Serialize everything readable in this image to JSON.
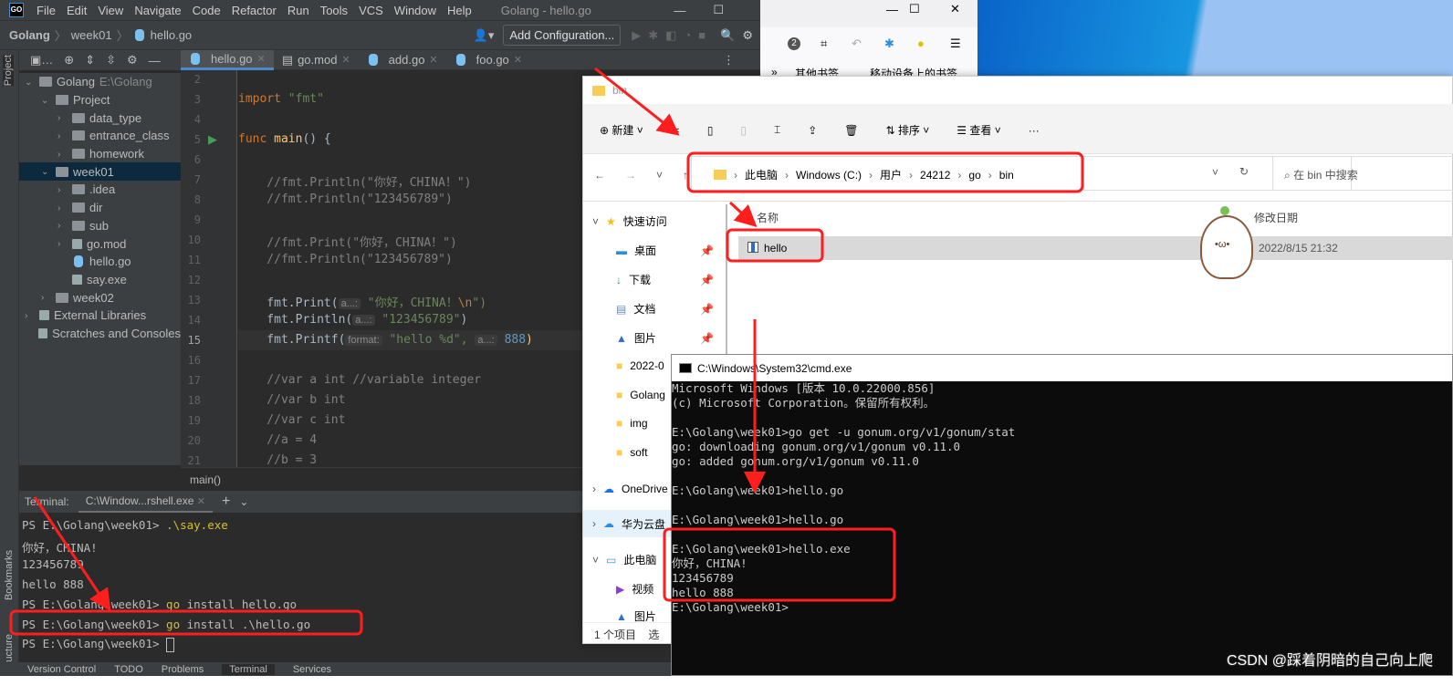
{
  "ide": {
    "title": "Golang - hello.go",
    "menu": [
      "File",
      "Edit",
      "View",
      "Navigate",
      "Code",
      "Refactor",
      "Run",
      "Tools",
      "VCS",
      "Window",
      "Help"
    ],
    "breadcrumb": [
      "Golang",
      "week01",
      "hello.go"
    ],
    "add_config": "Add Configuration...",
    "stripe_labels": {
      "project": "Project",
      "bookmarks": "Bookmarks",
      "structure": "Structure"
    },
    "tree": [
      {
        "label": "Golang",
        "hint": "E:\\Golang",
        "depth": 0,
        "open": true,
        "type": "folder"
      },
      {
        "label": "Project",
        "depth": 1,
        "open": true,
        "type": "folder"
      },
      {
        "label": "data_type",
        "depth": 2,
        "type": "folder"
      },
      {
        "label": "entrance_class",
        "depth": 2,
        "type": "folder"
      },
      {
        "label": "homework",
        "depth": 2,
        "type": "folder"
      },
      {
        "label": "week01",
        "depth": 1,
        "open": true,
        "type": "folder",
        "selected": true
      },
      {
        "label": ".idea",
        "depth": 2,
        "type": "folder"
      },
      {
        "label": "dir",
        "depth": 2,
        "type": "folder"
      },
      {
        "label": "sub",
        "depth": 2,
        "type": "folder"
      },
      {
        "label": "go.mod",
        "depth": 2,
        "type": "file"
      },
      {
        "label": "hello.go",
        "depth": 2,
        "type": "go"
      },
      {
        "label": "say.exe",
        "depth": 2,
        "type": "file"
      },
      {
        "label": "week02",
        "depth": 1,
        "type": "folder"
      },
      {
        "label": "External Libraries",
        "depth": 0,
        "type": "lib"
      },
      {
        "label": "Scratches and Consoles",
        "depth": 0,
        "type": "scratch"
      }
    ],
    "tabs": [
      "hello.go",
      "go.mod",
      "add.go",
      "foo.go"
    ],
    "line_numbers": [
      "2",
      "3",
      "4",
      "5",
      "6",
      "7",
      "8",
      "9",
      "10",
      "11",
      "12",
      "13",
      "14",
      "15",
      "16",
      "17",
      "18",
      "19",
      "20",
      "21"
    ],
    "code": {
      "l3a": "import",
      "l3b": " \"fmt\"",
      "l5a": "func",
      "l5b": " main",
      "l5c": "() {",
      "l7": "    //fmt.Println(\"你好，CHINA！\")",
      "l8": "    //fmt.Println(\"123456789\")",
      "l10": "    //fmt.Print(\"你好，CHINA！\")",
      "l11": "    //fmt.Println(\"123456789\")",
      "l13a": "    fmt.Print(",
      "l13h": "a...:",
      "l13s": "\"你好，CHINA！",
      "l13e": "\\n",
      "l13z": "\")",
      "l14a": "    fmt.Println(",
      "l14h": "a...:",
      "l14s": "\"123456789\"",
      "l14z": ")",
      "l15a": "    fmt.Printf(",
      "l15h": "format:",
      "l15s": "\"hello %d\",",
      "l15h2": "a...:",
      "l15n": "888",
      "l15z": ")",
      "l17": "    //var a int //variable integer",
      "l18": "    //var b int",
      "l19": "    //var c int",
      "l20": "    //a = 4",
      "l21": "    //b = 3"
    },
    "code_breadcrumb": "main()",
    "terminal": {
      "label": "Terminal:",
      "tab": "C:\\Window...rshell.exe",
      "lines": [
        {
          "prompt": "PS E:\\Golang\\week01> ",
          "cmd": ".\\say.exe"
        },
        {
          "prompt": "你好，CHINA!",
          "cmd": ""
        },
        {
          "prompt": "123456789",
          "cmd": ""
        },
        {
          "prompt": "hello 888",
          "cmd": ""
        },
        {
          "prompt": "PS E:\\Golang\\week01> ",
          "cmd": "go",
          "rest": " install hello.go"
        },
        {
          "prompt": "PS E:\\Golang\\week01> ",
          "cmd": "go",
          "rest": " install .\\hello.go"
        },
        {
          "prompt": "PS E:\\Golang\\week01> ",
          "cmd": ""
        }
      ]
    },
    "status_tabs": [
      "Version Control",
      "TODO",
      "Problems",
      "Terminal",
      "Services"
    ]
  },
  "browser": {
    "badge": "2",
    "bookmarks": [
      "其他书签",
      "移动设备上的书签"
    ]
  },
  "explorer": {
    "title": "bin",
    "toolbar": {
      "new": "新建",
      "sort": "排序",
      "view": "查看",
      "more": "···"
    },
    "path": [
      "此电脑",
      "Windows (C:)",
      "用户",
      "24212",
      "go",
      "bin"
    ],
    "search_placeholder": "在 bin 中搜索",
    "columns": {
      "name": "名称",
      "modified": "修改日期"
    },
    "files": [
      {
        "name": "hello",
        "modified": "2022/8/15 21:32"
      }
    ],
    "nav": [
      "快速访问",
      "桌面",
      "下载",
      "文档",
      "图片",
      "2022-0",
      "Golang",
      "img",
      "soft",
      "OneDrive",
      "华为云盘",
      "此电脑",
      "视频",
      "图片"
    ],
    "status": "1 个项目",
    "status2": "选"
  },
  "cmd": {
    "title": "C:\\Windows\\System32\\cmd.exe",
    "lines": [
      "Microsoft Windows [版本 10.0.22000.856]",
      "(c) Microsoft Corporation。保留所有权利。",
      "",
      "E:\\Golang\\week01>go get -u gonum.org/v1/gonum/stat",
      "go: downloading gonum.org/v1/gonum v0.11.0",
      "go: added gonum.org/v1/gonum v0.11.0",
      "",
      "E:\\Golang\\week01>hello.go",
      "",
      "E:\\Golang\\week01>hello.go",
      "",
      "E:\\Golang\\week01>hello.exe",
      "你好，CHINA!",
      "123456789",
      "hello 888",
      "E:\\Golang\\week01>"
    ]
  },
  "watermark": "CSDN @踩着阴暗的自己向上爬",
  "colors": {
    "annotation": "#ff1e1e",
    "ide_bg": "#2b2b2b",
    "accent": "#4a88c7"
  }
}
